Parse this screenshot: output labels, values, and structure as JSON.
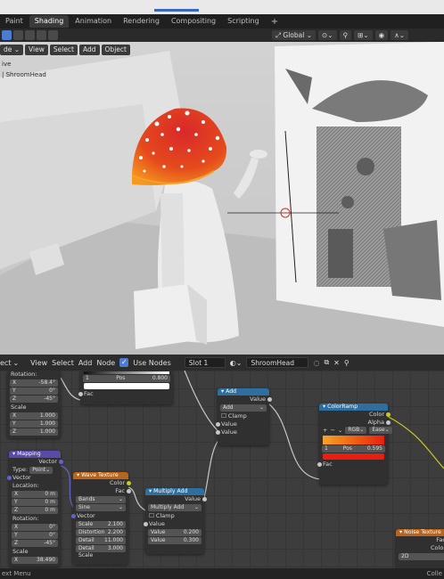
{
  "tabs": [
    "Paint",
    "Shading",
    "Animation",
    "Rendering",
    "Compositing",
    "Scripting",
    "+"
  ],
  "viewport_header": {
    "orientation": "Global"
  },
  "viewport_menu": [
    "de",
    "View",
    "Select",
    "Add",
    "Object"
  ],
  "viewport_overlay": {
    "line1": "ive",
    "line2": "| ShroomHead"
  },
  "node_header": {
    "menus": [
      "ect",
      "View",
      "Select",
      "Add",
      "Node"
    ],
    "use_nodes": "Use Nodes",
    "slot": "Slot 1",
    "material": "ShroomHead"
  },
  "nodes": {
    "mapping_top": {
      "rotation_label": "Rotation:",
      "rot": [
        [
          "X",
          "-58.4°"
        ],
        [
          "Y",
          "0°"
        ],
        [
          "Z",
          "-45°"
        ]
      ],
      "scale_label": "Scale",
      "scale": [
        [
          "X",
          "1.000"
        ],
        [
          "Y",
          "1.000"
        ],
        [
          "Z",
          "1.000"
        ]
      ]
    },
    "ramp_top": {
      "pos": "1",
      "pos_label": "Pos",
      "pos_val": "0.800",
      "fac": "Fac"
    },
    "add": {
      "title": "Add",
      "out": "Value",
      "mode": "Add",
      "clamp": "Clamp",
      "in1": "Value",
      "in2": "Value"
    },
    "colorramp": {
      "title": "ColorRamp",
      "color": "Color",
      "alpha": "Alpha",
      "mode": "RGB",
      "interp": "Ease",
      "idx": "1",
      "pos_label": "Pos",
      "pos_val": "0.595",
      "fac": "Fac"
    },
    "mapping": {
      "title": "Mapping",
      "vector_out": "Vector",
      "type_label": "Type:",
      "type": "Point",
      "vector_in": "Vector",
      "location_label": "Location:",
      "loc": [
        [
          "X",
          "0 m"
        ],
        [
          "Y",
          "0 m"
        ],
        [
          "Z",
          "0 m"
        ]
      ],
      "rotation_label": "Rotation:",
      "rot": [
        [
          "X",
          "0°"
        ],
        [
          "Y",
          "0°"
        ],
        [
          "Z",
          "-45°"
        ]
      ],
      "scale_label": "Scale",
      "scale": [
        [
          "X",
          "38.490"
        ]
      ]
    },
    "wave": {
      "title": "Wave Texture",
      "color": "Color",
      "fac": "Fac",
      "type": "Bands",
      "profile": "Sine",
      "vector": "Vector",
      "params": [
        [
          "Scale",
          "2.100"
        ],
        [
          "Distortion",
          "2.200"
        ],
        [
          "Detail",
          "11.000"
        ],
        [
          "Detail Scale",
          "3.000"
        ]
      ]
    },
    "multiply": {
      "title": "Multiply Add",
      "out": "Value",
      "mode": "Multiply Add",
      "clamp": "Clamp",
      "in": "Value",
      "v1": [
        "Value",
        "0.200"
      ],
      "v2": [
        "Value",
        "0.300"
      ]
    },
    "noise": {
      "title": "Noise Texture",
      "fac": "Fac",
      "color": "Color",
      "dim": "2D"
    }
  },
  "status": {
    "left": "ext Menu",
    "right": "Colle"
  },
  "colors": {
    "accent": "#4d7bd0",
    "node_vector": "#6363c7",
    "node_color": "#c7c729",
    "ramp_orange": "#f06a14",
    "ramp_red": "#e81f0f"
  }
}
